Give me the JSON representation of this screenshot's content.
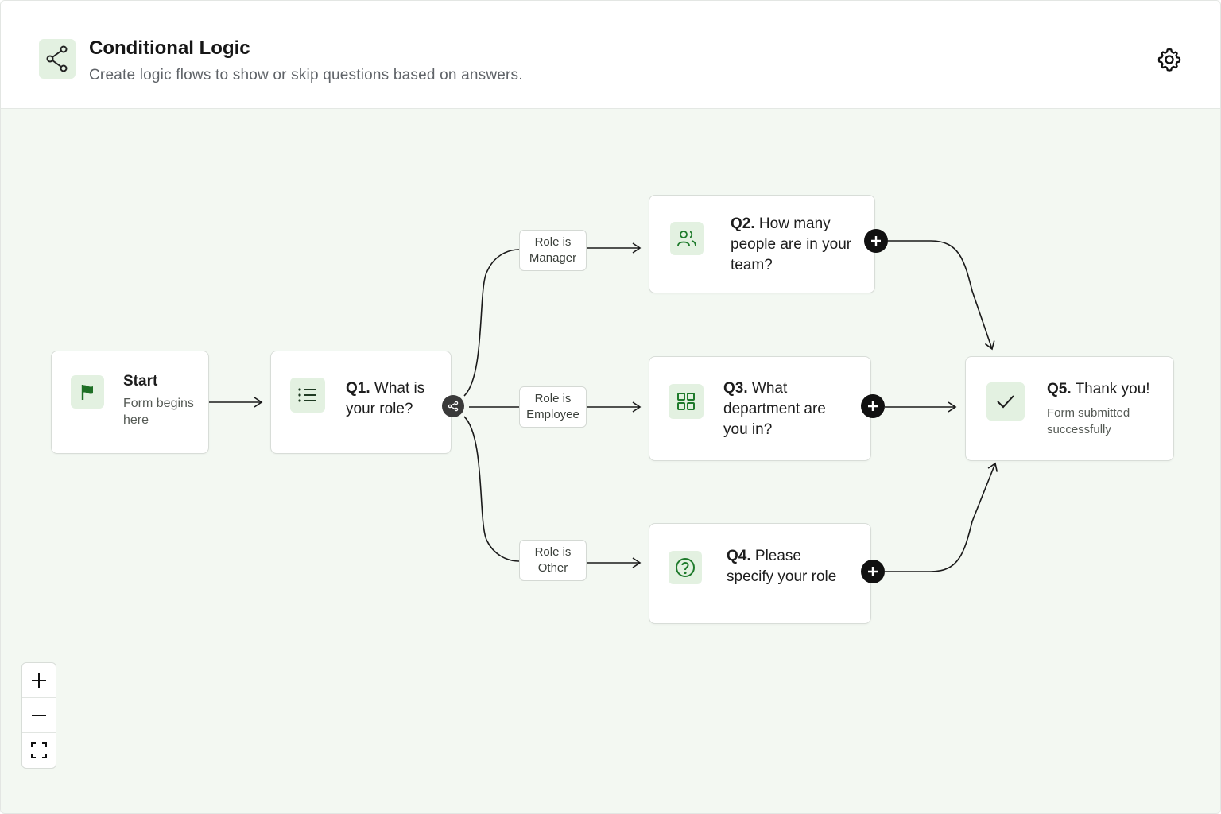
{
  "header": {
    "title": "Conditional Logic",
    "subtitle": "Create logic flows to show or skip questions based on answers.",
    "icon": "branch-share-icon",
    "settings_icon": "gear-icon"
  },
  "nodes": {
    "start": {
      "title": "Start",
      "sub": "Form begins here",
      "icon": "flag-icon"
    },
    "q1": {
      "num": "Q1.",
      "text": "What is your role?",
      "icon": "list-icon"
    },
    "q2": {
      "num": "Q2.",
      "text": "How many people are in your team?",
      "icon": "users-icon"
    },
    "q3": {
      "num": "Q3.",
      "text": "What department are you in?",
      "icon": "grid-icon"
    },
    "q4": {
      "num": "Q4.",
      "text": "Please specify your role",
      "icon": "question-circle-icon"
    },
    "q5": {
      "num": "Q5.",
      "text": "Thank you!",
      "sub": "Form submitted successfully",
      "icon": "check-icon"
    }
  },
  "conditions": {
    "manager": {
      "line1": "Role is",
      "line2": "Manager"
    },
    "employee": {
      "line1": "Role is",
      "line2": "Employee"
    },
    "other": {
      "line1": "Role is",
      "line2": "Other"
    }
  },
  "zoom_controls": {
    "zoom_in_icon": "plus-icon",
    "zoom_out_icon": "minus-icon",
    "fit_icon": "fit-screen-icon"
  },
  "colors": {
    "accent": "#1e7a2b",
    "accent_bg": "#e3f1e1",
    "canvas_bg": "#f3f8f2"
  }
}
